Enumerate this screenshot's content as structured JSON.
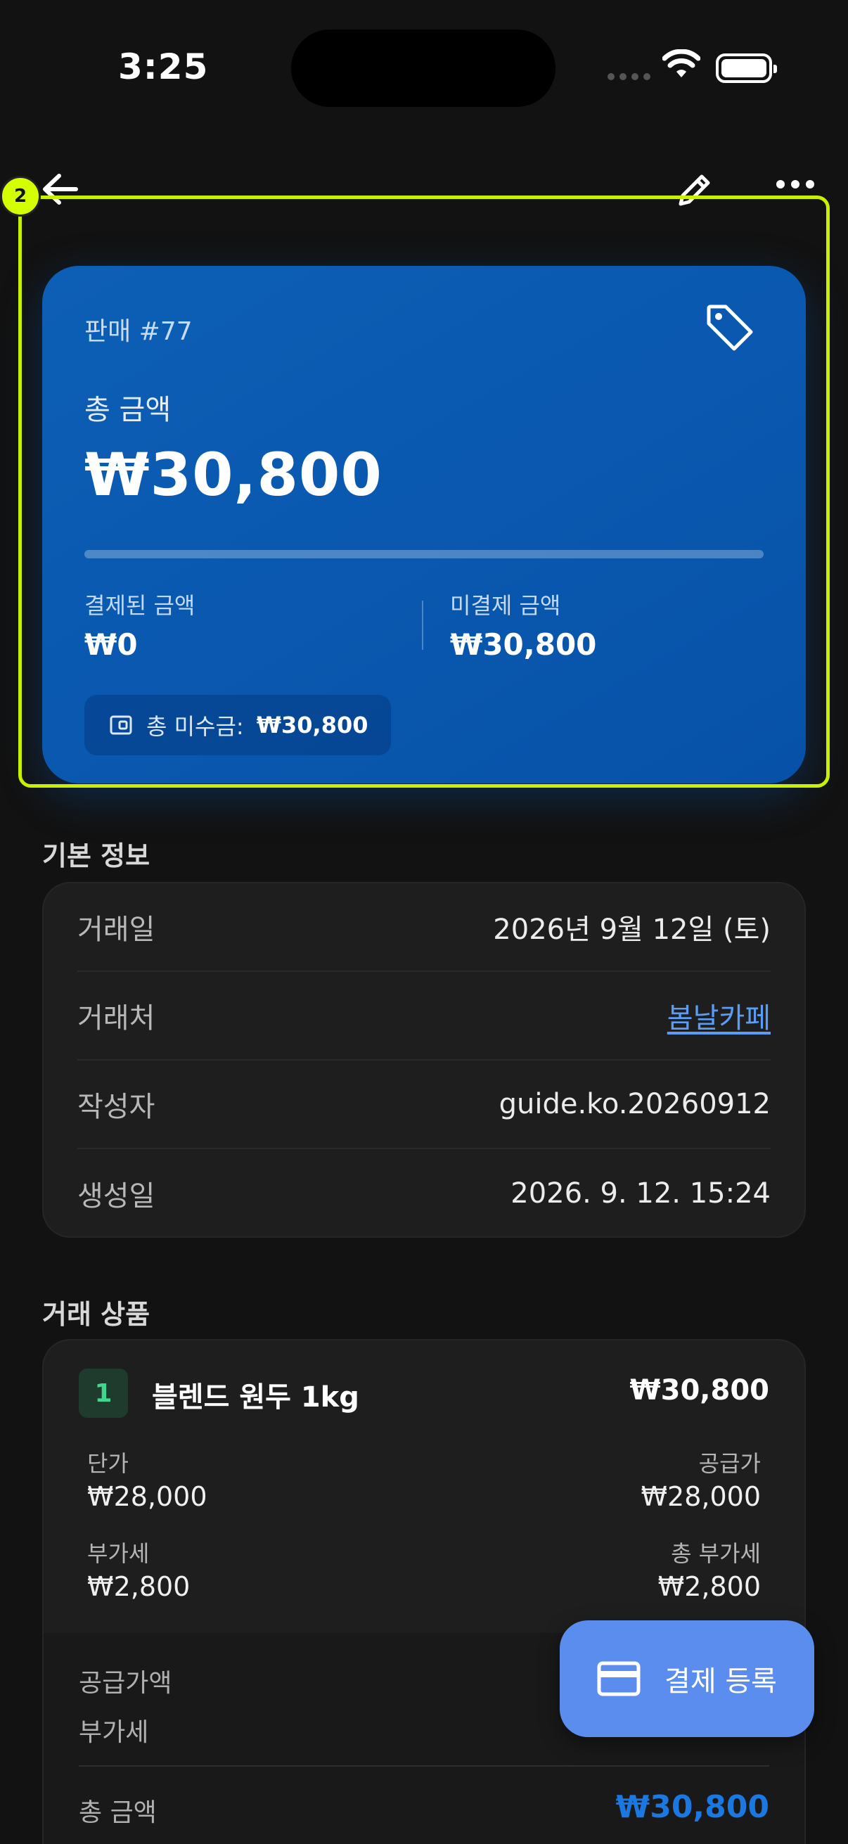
{
  "status_bar": {
    "time": "3:25"
  },
  "summary_card": {
    "sale_number": "판매 #77",
    "total_label": "총 금액",
    "total_amount": "₩30,800",
    "paid_fraction": 0,
    "paid_label": "결제된 금액",
    "paid_amount": "₩0",
    "unpaid_label": "미결제 금액",
    "unpaid_amount": "₩30,800",
    "receivable_label": "총 미수금:",
    "receivable_amount": "₩30,800"
  },
  "overlay": {
    "badge": "2",
    "color": "#c8f000"
  },
  "basic_info": {
    "title": "기본 정보",
    "rows": [
      {
        "key": "거래일",
        "value": "2026년 9월 12일 (토)"
      },
      {
        "key": "거래처",
        "value": "봄날카페"
      },
      {
        "key": "작성자",
        "value": "guide.ko.20260912"
      },
      {
        "key": "생성일",
        "value": "2026. 9. 12. 15:24"
      }
    ]
  },
  "items": {
    "title": "거래 상품",
    "list": [
      {
        "index": "1",
        "name": "블렌드 원두 1kg",
        "total": "₩30,800",
        "unit_price_label": "단가",
        "unit_price": "₩28,000",
        "supply_price_label": "공급가",
        "supply_price": "₩28,000",
        "vat_label": "부가세",
        "vat": "₩2,800",
        "vat_total_label": "총 부가세",
        "vat_total": "₩2,800"
      }
    ],
    "summary": {
      "supply_label": "공급가액",
      "vat_label": "부가세",
      "total_label": "총 금액",
      "total_value": "₩30,800"
    }
  },
  "fab": {
    "label": "결제 등록",
    "icon": "credit-card-icon"
  },
  "icons": {
    "back": "back-arrow-icon",
    "edit": "pencil-icon",
    "more": "more-horizontal-icon",
    "tag": "tag-icon",
    "wallet": "wallet-icon"
  },
  "colors": {
    "card_blue": "#0a58b0",
    "accent_link": "#5b9cf5",
    "total_blue": "#1a78e0",
    "fab": "#5b8def"
  }
}
